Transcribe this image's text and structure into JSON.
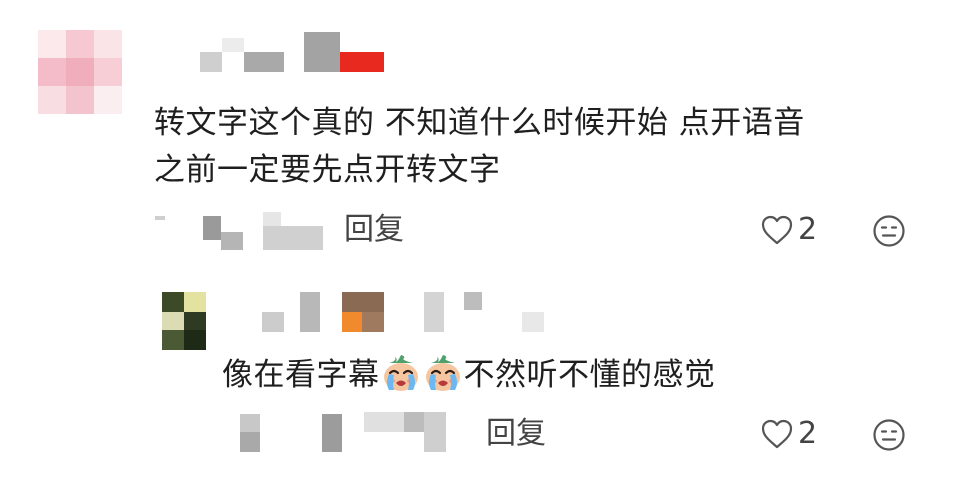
{
  "comments": [
    {
      "body_line1": "转文字这个真的 不知道什么时候开始 点开语音",
      "body_line2": "之前一定要先点开转文字",
      "reply_label": "回复",
      "like_count": "2"
    },
    {
      "body_before_emoji": "像在看字幕",
      "body_after_emoji": "不然听不懂的感觉",
      "reply_label": "回复",
      "like_count": "2",
      "emojis": [
        "crying-face-emoji",
        "crying-face-emoji"
      ]
    }
  ],
  "icons": {
    "like": "heart-outline-icon",
    "react": "expressionless-face-icon"
  },
  "colors": {
    "text": "#1f1f1f",
    "meta": "#444444",
    "icon": "#555555"
  }
}
